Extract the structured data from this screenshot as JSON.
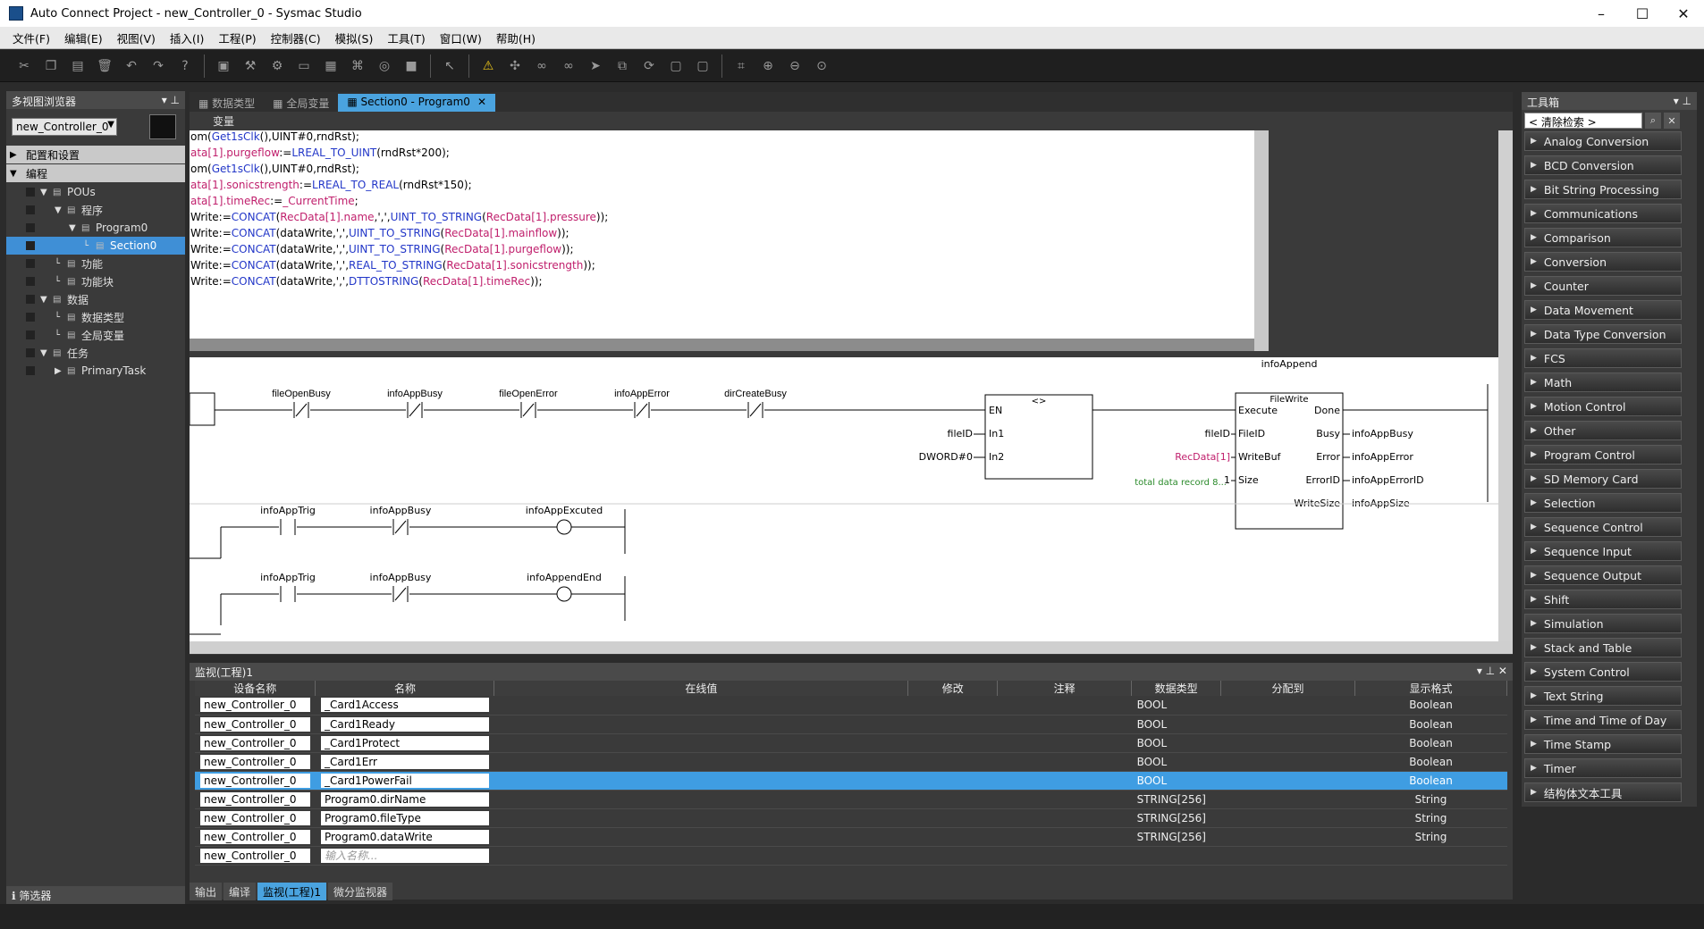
{
  "window": {
    "title": "Auto Connect Project - new_Controller_0 - Sysmac Studio"
  },
  "menu": [
    "文件(F)",
    "编辑(E)",
    "视图(V)",
    "插入(I)",
    "工程(P)",
    "控制器(C)",
    "模拟(S)",
    "工具(T)",
    "窗口(W)",
    "帮助(H)"
  ],
  "toolbar_icons": [
    "cut-icon",
    "copy-icon",
    "paste-icon",
    "delete-icon",
    "undo-icon",
    "redo-icon",
    "help-icon",
    "build-icon",
    "wrench-icon",
    "network-icon",
    "window-icon",
    "table-icon",
    "tree-icon",
    "binoculars-icon",
    "stop-icon",
    "pointer-icon",
    "warning-icon",
    "online-icon",
    "glasses-icon",
    "glasses-x-icon",
    "transfer-icon",
    "compare-icon",
    "cycle-icon",
    "layout-icon",
    "layout2-icon",
    "fit-icon",
    "zoom-in-icon",
    "zoom-out-icon",
    "zoom-reset-icon"
  ],
  "left": {
    "title": "多视图浏览器",
    "controller": "new_Controller_0",
    "tree": [
      {
        "label": "配置和设置",
        "kind": "section"
      },
      {
        "label": "编程",
        "kind": "section"
      },
      {
        "label": "POUs",
        "level": 1
      },
      {
        "label": "程序",
        "level": 2
      },
      {
        "label": "Program0",
        "level": 3
      },
      {
        "label": "Section0",
        "level": 4,
        "selected": true
      },
      {
        "label": "功能",
        "level": 2
      },
      {
        "label": "功能块",
        "level": 2
      },
      {
        "label": "数据",
        "level": 1
      },
      {
        "label": "数据类型",
        "level": 2
      },
      {
        "label": "全局变量",
        "level": 2
      },
      {
        "label": "任务",
        "level": 1
      },
      {
        "label": "PrimaryTask",
        "level": 2
      }
    ],
    "filter": "筛选器"
  },
  "editor": {
    "tabs": [
      "数据类型",
      "全局变量",
      "Section0 - Program0"
    ],
    "var_label": "变量",
    "st_lines": [
      [
        [
          "om(",
          ""
        ],
        [
          "Get1sClk",
          "kw"
        ],
        [
          "(),UINT#0,rndRst);",
          ""
        ]
      ],
      [
        [
          "ata[1].purgeflow",
          "v"
        ],
        [
          ":=",
          ""
        ],
        [
          "LREAL_TO_UINT",
          "kw"
        ],
        [
          "(rndRst*200);",
          ""
        ]
      ],
      [
        [
          "om(",
          ""
        ],
        [
          "Get1sClk",
          "kw"
        ],
        [
          "(),UINT#0,rndRst);",
          ""
        ]
      ],
      [
        [
          "ata[1].sonicstrength",
          "v"
        ],
        [
          ":=",
          ""
        ],
        [
          "LREAL_TO_REAL",
          "kw"
        ],
        [
          "(rndRst*150);",
          ""
        ]
      ],
      [
        [
          "ata[1].timeRec",
          "v"
        ],
        [
          ":=",
          ""
        ],
        [
          "_CurrentTime",
          "v"
        ],
        [
          ";",
          ""
        ]
      ],
      [
        [
          "Write:=",
          ""
        ],
        [
          "CONCAT",
          "kw"
        ],
        [
          "(",
          ""
        ],
        [
          "RecData[1].name",
          "v"
        ],
        [
          ",',',",
          ""
        ],
        [
          "UINT_TO_STRING",
          "kw"
        ],
        [
          "(",
          ""
        ],
        [
          "RecData[1].pressure",
          "v"
        ],
        [
          "));",
          ""
        ]
      ],
      [
        [
          "Write:=",
          ""
        ],
        [
          "CONCAT",
          "kw"
        ],
        [
          "(dataWrite,',',",
          ""
        ],
        [
          "UINT_TO_STRING",
          "kw"
        ],
        [
          "(",
          ""
        ],
        [
          "RecData[1].mainflow",
          "v"
        ],
        [
          "));",
          ""
        ]
      ],
      [
        [
          "Write:=",
          ""
        ],
        [
          "CONCAT",
          "kw"
        ],
        [
          "(dataWrite,',',",
          ""
        ],
        [
          "UINT_TO_STRING",
          "kw"
        ],
        [
          "(",
          ""
        ],
        [
          "RecData[1].purgeflow",
          "v"
        ],
        [
          "));",
          ""
        ]
      ],
      [
        [
          "Write:=",
          ""
        ],
        [
          "CONCAT",
          "kw"
        ],
        [
          "(dataWrite,',',",
          ""
        ],
        [
          "REAL_TO_STRING",
          "kw"
        ],
        [
          "(",
          ""
        ],
        [
          "RecData[1].sonicstrength",
          "v"
        ],
        [
          "));",
          ""
        ]
      ],
      [
        [
          "Write:=",
          ""
        ],
        [
          "CONCAT",
          "kw"
        ],
        [
          "(dataWrite,',',",
          ""
        ],
        [
          "DTTOSTRING",
          "kw"
        ],
        [
          "(",
          ""
        ],
        [
          "RecData[1].timeRec",
          "v"
        ],
        [
          "));",
          ""
        ]
      ]
    ],
    "ladder": {
      "contacts1": [
        "fileOpenBusy",
        "infoAppBusy",
        "fileOpenError",
        "infoAppError",
        "dirCreateBusy"
      ],
      "cmp": {
        "op": "<>",
        "en": "EN",
        "in1": "In1",
        "in2": "In2",
        "in1_var": "fileID",
        "in2_var": "DWORD#0"
      },
      "fb": {
        "instance": "infoAppend",
        "type": "FileWrite",
        "inputs": [
          "Execute",
          "FileID",
          "WriteBuf",
          "Size"
        ],
        "outputs": [
          "Done",
          "Busy",
          "Error",
          "ErrorID",
          "WriteSize"
        ],
        "in_vars": [
          "",
          "fileID",
          "RecData[1]",
          "1"
        ],
        "out_vars": [
          "",
          "infoAppBusy",
          "infoAppError",
          "infoAppErrorID",
          "infoAppSize"
        ],
        "comment": "total data record 8..."
      },
      "rung2": {
        "contacts": [
          "infoAppTrig",
          "infoAppBusy"
        ],
        "coil": "infoAppExcuted"
      },
      "rung3": {
        "contacts": [
          "infoAppTrig",
          "infoAppBusy"
        ],
        "coil": "infoAppendEnd"
      }
    }
  },
  "watch": {
    "title": "监视(工程)1",
    "columns": [
      "设备名称",
      "名称",
      "在线值",
      "修改",
      "注释",
      "数据类型",
      "分配到",
      "显示格式"
    ],
    "rows": [
      [
        "new_Controller_0",
        "_Card1Access",
        "BOOL",
        "Boolean"
      ],
      [
        "new_Controller_0",
        "_Card1Ready",
        "BOOL",
        "Boolean"
      ],
      [
        "new_Controller_0",
        "_Card1Protect",
        "BOOL",
        "Boolean"
      ],
      [
        "new_Controller_0",
        "_Card1Err",
        "BOOL",
        "Boolean"
      ],
      [
        "new_Controller_0",
        "_Card1PowerFail",
        "BOOL",
        "Boolean"
      ],
      [
        "new_Controller_0",
        "Program0.dirName",
        "STRING[256]",
        "String"
      ],
      [
        "new_Controller_0",
        "Program0.fileType",
        "STRING[256]",
        "String"
      ],
      [
        "new_Controller_0",
        "Program0.dataWrite",
        "STRING[256]",
        "String"
      ]
    ],
    "selected_row": 4,
    "last_device": "new_Controller_0",
    "input_placeholder": "输入名称...",
    "bottom_tabs": [
      "输出",
      "编译",
      "监视(工程)1",
      "微分监视器"
    ]
  },
  "toolbox": {
    "title": "工具箱",
    "search": "< 清除检索 >",
    "items": [
      "Analog Conversion",
      "BCD Conversion",
      "Bit String Processing",
      "Communications",
      "Comparison",
      "Conversion",
      "Counter",
      "Data Movement",
      "Data Type Conversion",
      "FCS",
      "Math",
      "Motion Control",
      "Other",
      "Program Control",
      "SD Memory Card",
      "Selection",
      "Sequence Control",
      "Sequence Input",
      "Sequence Output",
      "Shift",
      "Simulation",
      "Stack and Table",
      "System Control",
      "Text String",
      "Time and Time of Day",
      "Time Stamp",
      "Timer",
      "结构体文本工具"
    ]
  },
  "colors": {
    "accent": "#4aa3df",
    "keyword": "#2337c8",
    "variable": "#c01f6c"
  }
}
